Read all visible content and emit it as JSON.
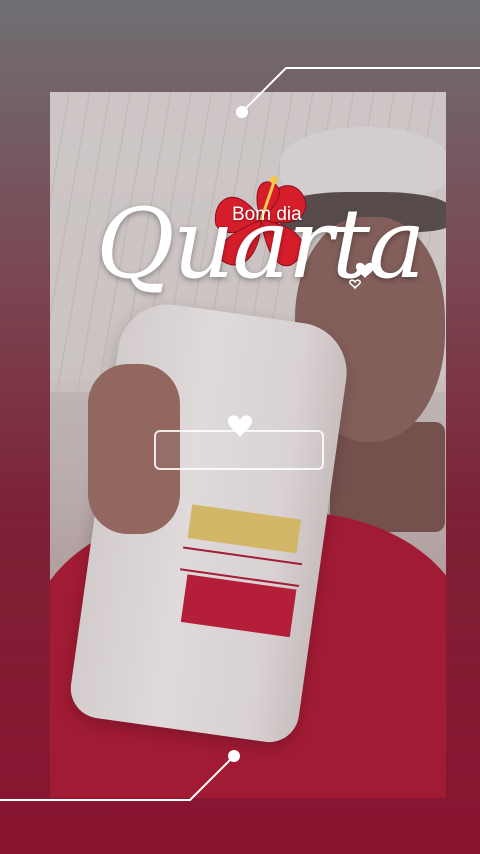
{
  "greeting": {
    "small_text": "Bom dia",
    "large_text": "Quarta"
  },
  "decor": {
    "flower": "hibiscus-icon",
    "heart": "heart-icon",
    "accent_color": "#b01d37"
  },
  "text_box": {
    "value": ""
  }
}
